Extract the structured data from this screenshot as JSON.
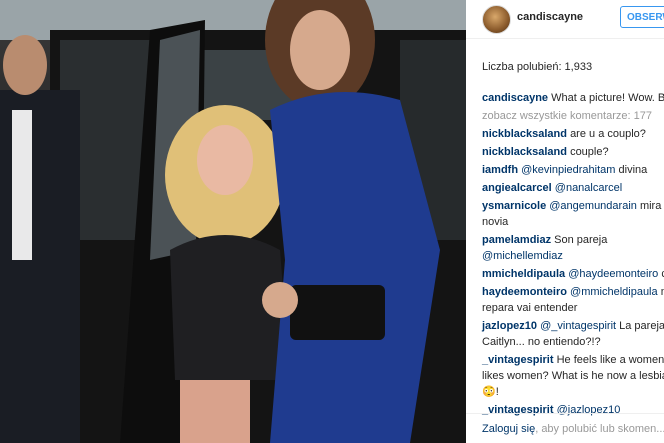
{
  "post": {
    "photo_label": "street photo: two women stepping out of a black car",
    "username": "candiscayne",
    "follow_label": "OBSERWUJ",
    "likes_text": "Liczba polubień: 1,933",
    "caption": {
      "user": "candiscayne",
      "text": "What a picture! Wow. Broadway!"
    },
    "see_all": "zobacz wszystkie komentarze: 177",
    "comments": [
      {
        "user": "nickblacksaland",
        "text": "are u a couplo?"
      },
      {
        "user": "nickblacksaland",
        "text": "couple?"
      },
      {
        "user": "iamdfh",
        "mention": "@kevinpiedrahitam",
        "text": "divina"
      },
      {
        "user": "angiealcarcel",
        "mention": "@nanalcarcel",
        "text": ""
      },
      {
        "user": "ysmarnicole",
        "mention": "@angemundarain",
        "text": "mira a",
        "line2": "novia"
      },
      {
        "user": "pamelamdiaz",
        "text": "Son pareja",
        "line2_mention": "@michellemdiaz"
      },
      {
        "user": "mmicheldipaula",
        "mention": "@haydeemonteiro",
        "text": "ca"
      },
      {
        "user": "haydeemonteiro",
        "mention": "@mmicheldipaula",
        "text": "ma",
        "line2": "repara vai entender"
      },
      {
        "user": "jazlopez10",
        "mention": "@_vintagespirit",
        "text": "La pareja d",
        "line2": "Caitlyn... no entiendo?!?"
      },
      {
        "user": "_vintagespirit",
        "text": "He feels like a women l",
        "line2": "likes women? What is he now a lesbia",
        "line3": "😳!"
      },
      {
        "user": "_vintagespirit",
        "mention": "@jazlopez10",
        "text": ""
      }
    ],
    "footer": {
      "login": "Zaloguj się",
      "rest": ", aby polubić lub skomen..."
    }
  }
}
